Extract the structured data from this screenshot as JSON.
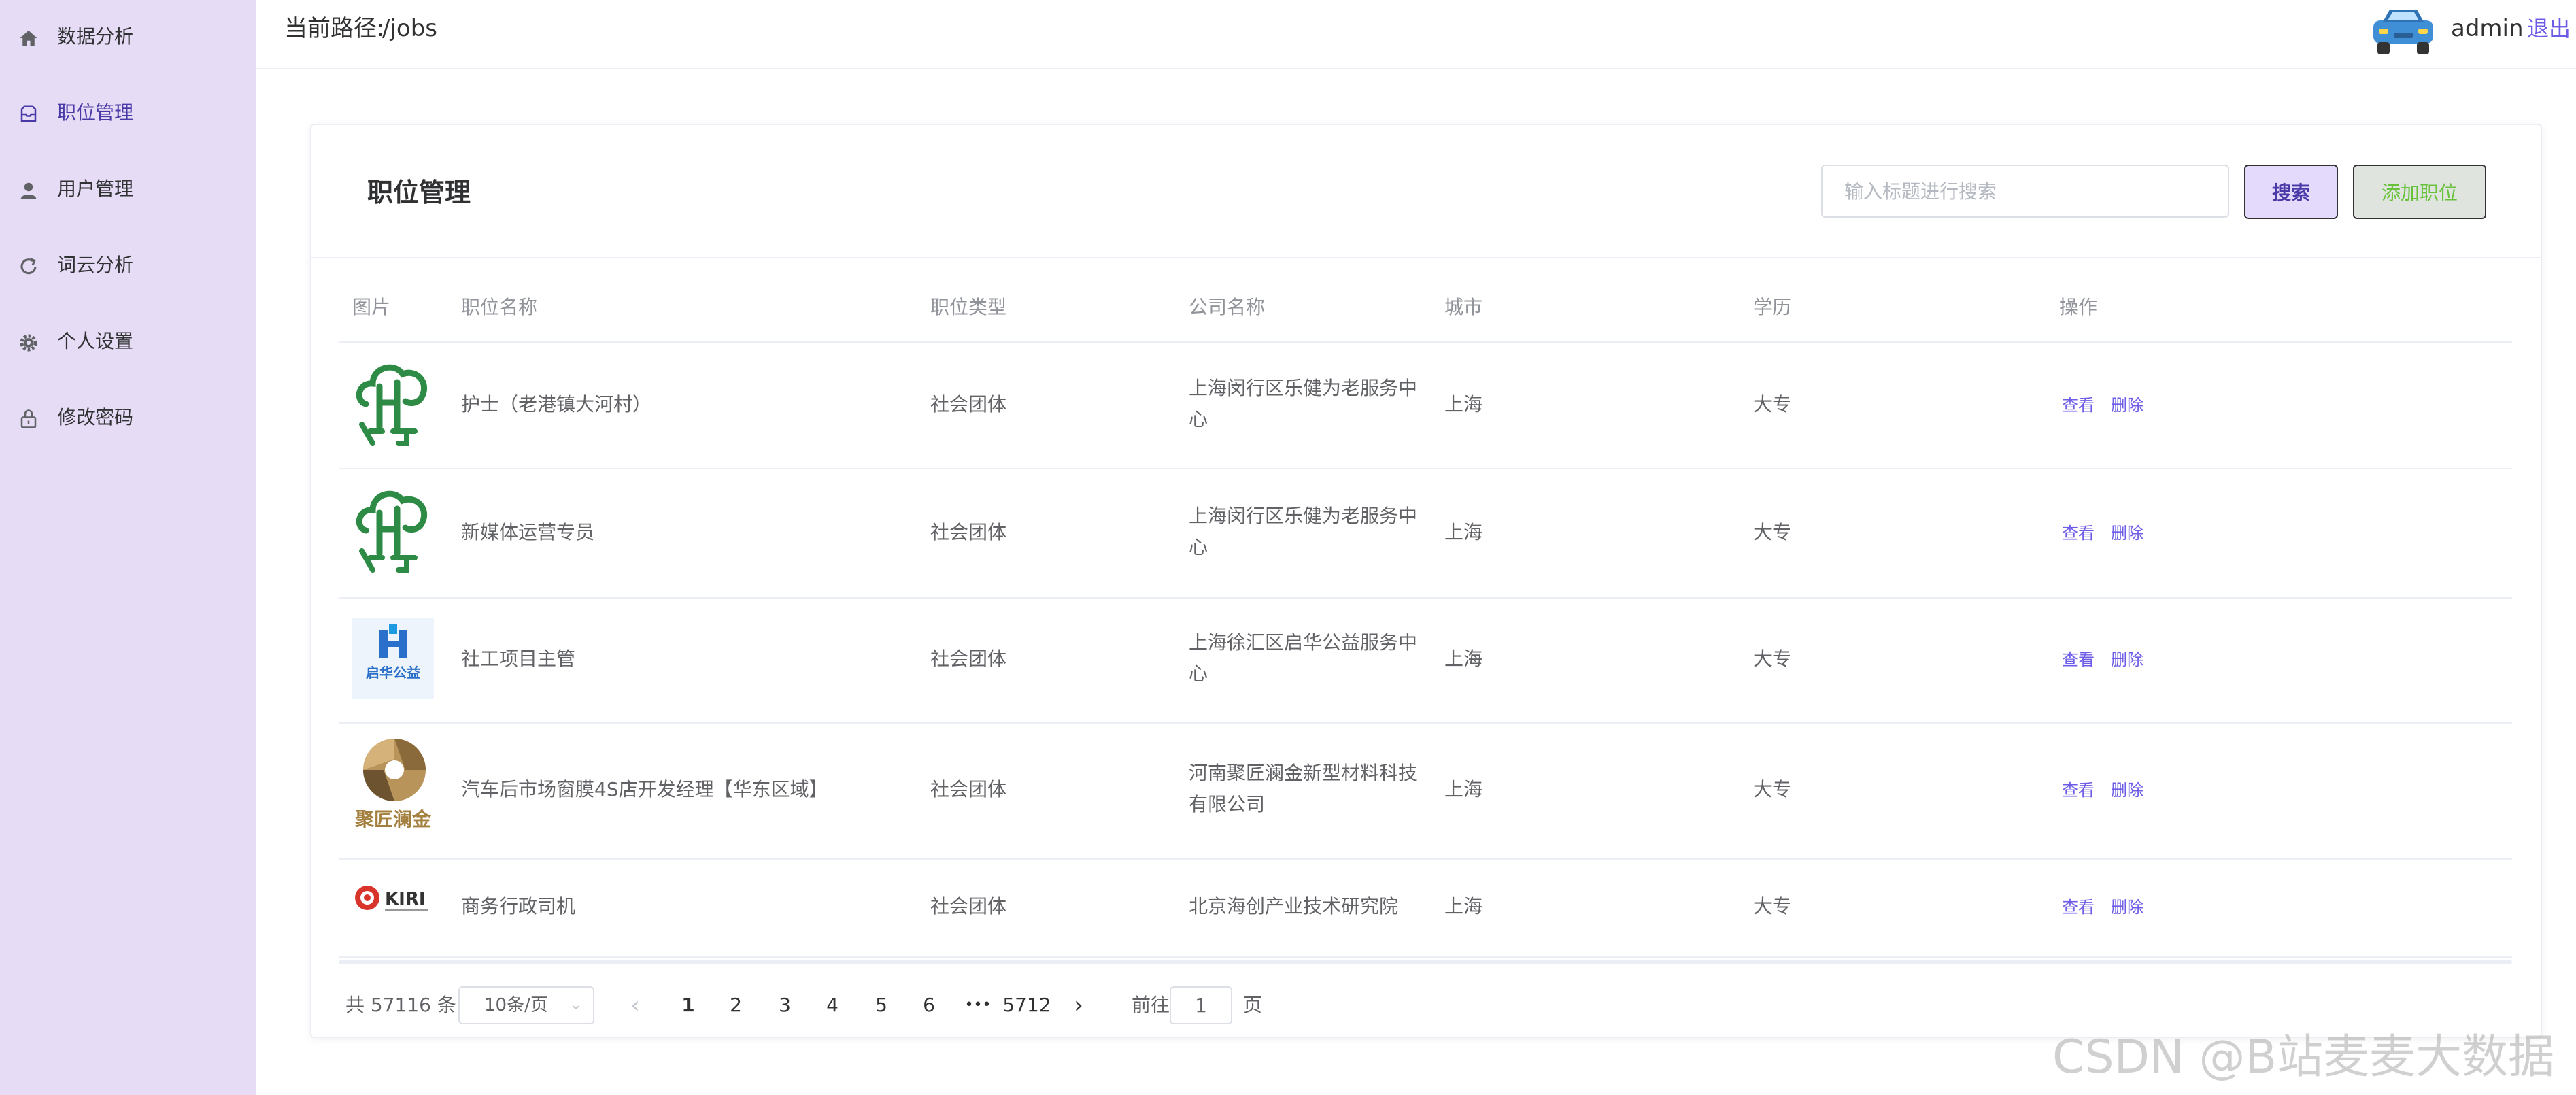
{
  "sidebar": {
    "items": [
      {
        "label": "数据分析",
        "icon": "home-icon"
      },
      {
        "label": "职位管理",
        "icon": "inbox-icon"
      },
      {
        "label": "用户管理",
        "icon": "user-icon"
      },
      {
        "label": "词云分析",
        "icon": "refresh-icon"
      },
      {
        "label": "个人设置",
        "icon": "gear-icon"
      },
      {
        "label": "修改密码",
        "icon": "lock-icon"
      }
    ],
    "active_index": 1
  },
  "header": {
    "breadcrumb_label": "当前路径:",
    "breadcrumb_path": "/jobs",
    "username": "admin",
    "logout_label": "退出"
  },
  "card": {
    "title": "职位管理",
    "search_placeholder": "输入标题进行搜索",
    "search_value": "",
    "search_button": "搜索",
    "add_button": "添加职位"
  },
  "table": {
    "columns": [
      "图片",
      "职位名称",
      "职位类型",
      "公司名称",
      "城市",
      "学历",
      "操作"
    ],
    "rows": [
      {
        "logo": "lt-green-logo",
        "title": "护士（老港镇大河村）",
        "type": "社会团体",
        "company_line1": "上海闵行区乐健为老服务中",
        "company_line2": "心",
        "city": "上海",
        "education": "大专",
        "view": "查看",
        "delete": "删除"
      },
      {
        "logo": "lt-green-logo",
        "title": "新媒体运营专员",
        "type": "社会团体",
        "company_line1": "上海闵行区乐健为老服务中",
        "company_line2": "心",
        "city": "上海",
        "education": "大专",
        "view": "查看",
        "delete": "删除"
      },
      {
        "logo": "qihua-logo",
        "logo_text": "启华公益",
        "title": "社工项目主管",
        "type": "社会团体",
        "company_line1": "上海徐汇区启华公益服务中",
        "company_line2": "心",
        "city": "上海",
        "education": "大专",
        "view": "查看",
        "delete": "删除"
      },
      {
        "logo": "jujiang-logo",
        "logo_text": "聚匠澜金",
        "title": "汽车后市场窗膜4S店开发经理【华东区域】",
        "type": "社会团体",
        "company_line1": "河南聚匠澜金新型材料科技",
        "company_line2": "有限公司",
        "city": "上海",
        "education": "大专",
        "view": "查看",
        "delete": "删除"
      },
      {
        "logo": "kiri-logo",
        "logo_text": "KIRI",
        "title": "商务行政司机",
        "type": "社会团体",
        "company_line1": "北京海创产业技术研究院",
        "company_line2": "",
        "city": "上海",
        "education": "大专",
        "view": "查看",
        "delete": "删除"
      }
    ]
  },
  "pagination": {
    "total_label": "共 57116 条",
    "page_size": "10条/页",
    "pages": [
      "1",
      "2",
      "3",
      "4",
      "5",
      "6",
      "•••",
      "5712"
    ],
    "current_page": "1",
    "goto_label": "前往",
    "goto_value": "1",
    "page_suffix": "页"
  },
  "watermark": "CSDN @B站麦麦大数据",
  "colors": {
    "sidebar_bg": "#e6dcf5",
    "accent": "#6c5ce7",
    "add_button_text": "#67c23a"
  }
}
